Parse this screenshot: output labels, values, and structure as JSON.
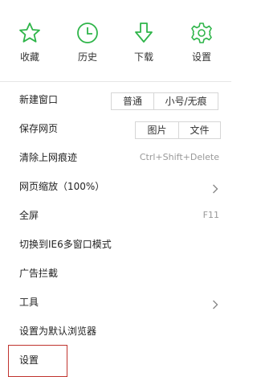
{
  "top_actions": [
    {
      "label": "收藏",
      "icon": "star-icon"
    },
    {
      "label": "历史",
      "icon": "clock-icon"
    },
    {
      "label": "下载",
      "icon": "download-icon"
    },
    {
      "label": "设置",
      "icon": "gear-icon"
    }
  ],
  "menu": {
    "new_window": {
      "label": "新建窗口",
      "options": [
        "普通",
        "小号/无痕"
      ]
    },
    "save_page": {
      "label": "保存网页",
      "options": [
        "图片",
        "文件"
      ]
    },
    "clear_history": {
      "label": "清除上网痕迹",
      "shortcut": "Ctrl+Shift+Delete"
    },
    "zoom": {
      "label": "网页缩放（100%）"
    },
    "fullscreen": {
      "label": "全屏",
      "shortcut": "F11"
    },
    "ie6_mode": {
      "label": "切换到IE6多窗口模式"
    },
    "ad_block": {
      "label": "广告拦截"
    },
    "tools": {
      "label": "工具"
    },
    "set_default": {
      "label": "设置为默认浏览器"
    },
    "settings": {
      "label": "设置"
    }
  },
  "colors": {
    "accent": "#2fb54a",
    "highlight": "#c0342e"
  }
}
